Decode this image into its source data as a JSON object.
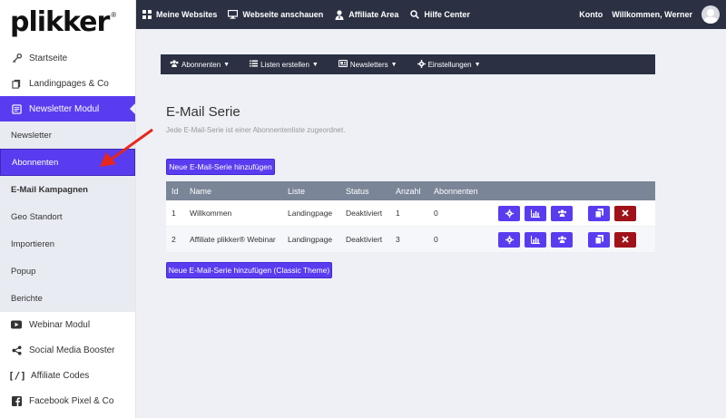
{
  "logo": {
    "text": "plikker",
    "reg": "®"
  },
  "sidebar": {
    "items": [
      {
        "label": "Startseite",
        "icon": "key-icon"
      },
      {
        "label": "Landingpages & Co",
        "icon": "pages-icon"
      },
      {
        "label": "Newsletter Modul",
        "icon": "newsletter-icon",
        "active": true
      }
    ],
    "subitems": [
      {
        "label": "Newsletter"
      },
      {
        "label": "Abonnenten",
        "selected": true
      },
      {
        "label": "E-Mail Kampagnen",
        "bold": true
      },
      {
        "label": "Geo Standort"
      },
      {
        "label": "Importieren"
      },
      {
        "label": "Popup"
      },
      {
        "label": "Berichte"
      }
    ],
    "items_bottom": [
      {
        "label": "Webinar Modul",
        "icon": "youtube-icon"
      },
      {
        "label": "Social Media Booster",
        "icon": "share-icon"
      },
      {
        "label": "Affiliate Codes",
        "icon": "code-icon"
      },
      {
        "label": "Facebook Pixel & Co",
        "icon": "facebook-icon"
      }
    ]
  },
  "topbar": {
    "links": [
      {
        "label": "Meine Websites",
        "icon": "grid-icon"
      },
      {
        "label": "Webseite anschauen",
        "icon": "monitor-icon"
      },
      {
        "label": "Affiliate Area",
        "icon": "user-tie-icon"
      },
      {
        "label": "Hilfe Center",
        "icon": "search-icon"
      }
    ],
    "konto": "Konto",
    "welcome": "Willkommen, Werner"
  },
  "subnav": [
    {
      "label": "Abonnenten",
      "icon": "users-icon"
    },
    {
      "label": "Listen erstellen",
      "icon": "list-icon"
    },
    {
      "label": "Newsletters",
      "icon": "newspaper-icon"
    },
    {
      "label": "Einstellungen",
      "icon": "gear-icon"
    }
  ],
  "main": {
    "title": "E-Mail Serie",
    "subtitle": "Jede E-Mail-Serie ist einer Abonnentenliste zugeordnet.",
    "add_button": "Neue E-Mail-Serie hinzufügen",
    "add_classic_button": "Neue E-Mail-Serie hinzufügen (Classic Theme)"
  },
  "table": {
    "headers": [
      "Id",
      "Name",
      "Liste",
      "Status",
      "Anzahl",
      "Abonnenten"
    ],
    "rows": [
      {
        "id": "1",
        "name": "Willkommen",
        "liste": "Landingpage",
        "status": "Deaktiviert",
        "anzahl": "1",
        "abonnenten": "0"
      },
      {
        "id": "2",
        "name": "Affiliate plikker® Webinar",
        "liste": "Landingpage",
        "status": "Deaktiviert",
        "anzahl": "3",
        "abonnenten": "0"
      }
    ]
  },
  "colors": {
    "accent": "#5a3cf0",
    "dark": "#2b3143",
    "danger": "#a0121a",
    "table_header": "#7a8597"
  }
}
